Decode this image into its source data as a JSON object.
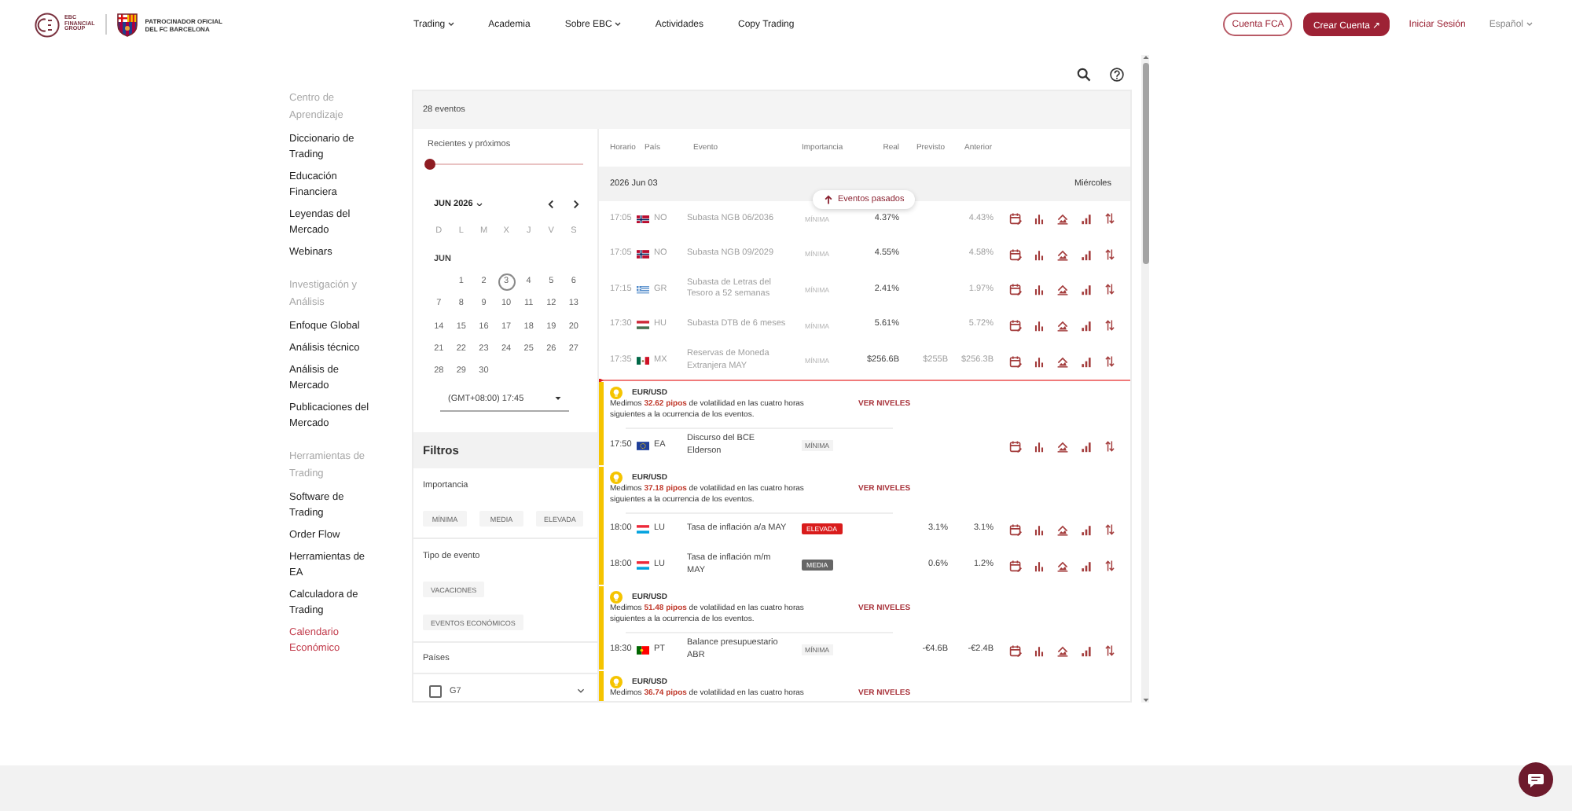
{
  "header": {
    "logo_text": "EBC FINANCIAL GROUP",
    "sponsor_text": "PATROCINADOR OFICIAL DEL FC BARCELONA",
    "nav": [
      {
        "label": "Trading",
        "has_menu": true
      },
      {
        "label": "Academia",
        "has_menu": false
      },
      {
        "label": "Sobre EBC",
        "has_menu": true
      },
      {
        "label": "Actividades",
        "has_menu": false
      },
      {
        "label": "Copy Trading",
        "has_menu": false
      }
    ],
    "actions": [
      {
        "label": "Cuenta FCA",
        "kind": "outline"
      },
      {
        "label": "Crear Cuenta ↗",
        "kind": "filled"
      },
      {
        "label": "Iniciar Sesión",
        "kind": "link"
      },
      {
        "label": "Español",
        "kind": "language"
      }
    ]
  },
  "sidebar": {
    "sections": [
      {
        "title": "Centro de Aprendizaje",
        "items": [
          {
            "label": "Diccionario de Trading",
            "selected": false
          },
          {
            "label": "Educación Financiera",
            "selected": false
          },
          {
            "label": "Leyendas del Mercado",
            "selected": false
          },
          {
            "label": "Webinars",
            "selected": false
          }
        ]
      },
      {
        "title": "Investigación y Análisis",
        "items": [
          {
            "label": "Enfoque Global",
            "selected": false
          },
          {
            "label": "Análisis técnico",
            "selected": false
          },
          {
            "label": "Análisis de Mercado",
            "selected": false
          },
          {
            "label": "Publicaciones del Mercado",
            "selected": false
          }
        ]
      },
      {
        "title": "Herramientas de Trading",
        "items": [
          {
            "label": "Software de Trading",
            "selected": false
          },
          {
            "label": "Order Flow",
            "selected": false
          },
          {
            "label": "Herramientas de EA",
            "selected": false
          },
          {
            "label": "Calculadora de Trading",
            "selected": false
          },
          {
            "label": "Calendario Económico",
            "selected": true
          }
        ]
      }
    ]
  },
  "calendar": {
    "event_count": "28 eventos",
    "range": {
      "label": "Recientes y próximos",
      "level": 0
    },
    "month_label": "JUN 2026",
    "weekdays": [
      "D",
      "L",
      "M",
      "X",
      "J",
      "V",
      "S"
    ],
    "month_heading": "JUN",
    "weeks": [
      {
        "kind": "leading",
        "days": [
          {
            "day": "1",
            "selected": false
          },
          {
            "day": "2",
            "selected": false
          },
          {
            "day": "3",
            "selected": true
          },
          {
            "day": "4",
            "selected": false
          },
          {
            "day": "5",
            "selected": false
          },
          {
            "day": "6",
            "selected": false
          }
        ]
      },
      {
        "kind": "full",
        "days": [
          {
            "day": "7",
            "selected": false
          },
          {
            "day": "8",
            "selected": false
          },
          {
            "day": "9",
            "selected": false
          },
          {
            "day": "10",
            "selected": false
          },
          {
            "day": "11",
            "selected": false
          },
          {
            "day": "12",
            "selected": false
          },
          {
            "day": "13",
            "selected": false
          }
        ]
      },
      {
        "kind": "full",
        "days": [
          {
            "day": "14",
            "selected": false
          },
          {
            "day": "15",
            "selected": false
          },
          {
            "day": "16",
            "selected": false
          },
          {
            "day": "17",
            "selected": false
          },
          {
            "day": "18",
            "selected": false
          },
          {
            "day": "19",
            "selected": false
          },
          {
            "day": "20",
            "selected": false
          }
        ]
      },
      {
        "kind": "full",
        "days": [
          {
            "day": "21",
            "selected": false
          },
          {
            "day": "22",
            "selected": false
          },
          {
            "day": "23",
            "selected": false
          },
          {
            "day": "24",
            "selected": false
          },
          {
            "day": "25",
            "selected": false
          },
          {
            "day": "26",
            "selected": false
          },
          {
            "day": "27",
            "selected": false
          }
        ]
      },
      {
        "kind": "trailing",
        "days": [
          {
            "day": "28",
            "selected": false
          },
          {
            "day": "29",
            "selected": false
          },
          {
            "day": "30",
            "selected": false
          }
        ]
      }
    ],
    "timezone": "(GMT+08:00) 17:45"
  },
  "filters": {
    "title": "Filtros",
    "groups": [
      {
        "title": "Importancia",
        "kind": "chips",
        "options": [
          {
            "label": "MÍNIMA",
            "selected": false
          },
          {
            "label": "MEDIA",
            "selected": false
          },
          {
            "label": "ELEVADA",
            "selected": false
          }
        ]
      },
      {
        "title": "Tipo de evento",
        "kind": "chips",
        "options": [
          {
            "label": "VACACIONES",
            "selected": false
          },
          {
            "label": "EVENTOS ECONÓMICOS",
            "selected": false
          }
        ]
      },
      {
        "title": "Países",
        "kind": "checklist",
        "options": [
          {
            "label": "G7",
            "checked": false,
            "expanded": false
          }
        ]
      }
    ]
  },
  "events": {
    "columns": [
      "Horario",
      "País",
      "Evento",
      "Importancia",
      "Real",
      "Previsto",
      "Anterior"
    ],
    "date": "2026 Jun 03",
    "weekday": "Miércoles",
    "past_button": "Eventos pasados",
    "past_rows": [
      {
        "time": "17:05",
        "country": {
          "code": "NO",
          "kind": "norway"
        },
        "event": "Subasta NGB 06/2036",
        "importance": {
          "label": "MÍNIMA",
          "kind": "low"
        },
        "actual": "4.37%",
        "previous": "4.43%",
        "past": true
      },
      {
        "time": "17:05",
        "country": {
          "code": "NO",
          "kind": "norway"
        },
        "event": "Subasta NGB 09/2029",
        "importance": {
          "label": "MÍNIMA",
          "kind": "low"
        },
        "actual": "4.55%",
        "previous": "4.58%",
        "past": true
      },
      {
        "time": "17:15",
        "country": {
          "code": "GR",
          "kind": "greece"
        },
        "event": "Subasta de Letras del Tesoro a 52 semanas",
        "importance": {
          "label": "MÍNIMA",
          "kind": "low"
        },
        "actual": "2.41%",
        "previous": "1.97%",
        "past": true
      },
      {
        "time": "17:30",
        "country": {
          "code": "HU",
          "kind": "hungary"
        },
        "event": "Subasta DTB de 6 meses",
        "importance": {
          "label": "MÍNIMA",
          "kind": "low"
        },
        "actual": "5.61%",
        "previous": "5.72%",
        "past": true
      },
      {
        "time": "17:35",
        "country": {
          "code": "MX",
          "kind": "mexico"
        },
        "event": "Reservas de Moneda Extranjera MAY",
        "importance": {
          "label": "MÍNIMA",
          "kind": "low"
        },
        "actual": "$256.6B",
        "forecast": "$255B",
        "previous": "$256.3B",
        "past": true
      }
    ],
    "groups": [
      {
        "pair": "EUR/USD",
        "message": "Medimos **32.62 pipos** de volatilidad en las cuatro horas siguientes a la ocurrencia de los eventos.",
        "link": "VER NIVELES",
        "rows": [
          {
            "time": "17:50",
            "country": {
              "code": "EA",
              "kind": "european_union"
            },
            "event": "Discurso del BCE Elderson",
            "importance": {
              "label": "MÍNIMA",
              "kind": "low"
            },
            "past": false
          }
        ]
      },
      {
        "pair": "EUR/USD",
        "message": "Medimos **37.18 pipos** de volatilidad en las cuatro horas siguientes a la ocurrencia de los eventos.",
        "link": "VER NIVELES",
        "rows": [
          {
            "time": "18:00",
            "country": {
              "code": "LU",
              "kind": "luxembourg"
            },
            "event": "Tasa de inflación a/a MAY",
            "importance": {
              "label": "ELEVADA",
              "kind": "high"
            },
            "forecast": "3.1%",
            "previous": "3.1%",
            "past": false
          },
          {
            "time": "18:00",
            "country": {
              "code": "LU",
              "kind": "luxembourg"
            },
            "event": "Tasa de inflación m/m MAY",
            "importance": {
              "label": "MEDIA",
              "kind": "medium"
            },
            "forecast": "0.6%",
            "previous": "1.2%",
            "past": false
          }
        ]
      },
      {
        "pair": "EUR/USD",
        "message": "Medimos **51.48 pipos** de volatilidad en las cuatro horas siguientes a la ocurrencia de los eventos.",
        "link": "VER NIVELES",
        "rows": [
          {
            "time": "18:30",
            "country": {
              "code": "PT",
              "kind": "portugal"
            },
            "event": "Balance presupuestario ABR",
            "importance": {
              "label": "MÍNIMA",
              "kind": "low"
            },
            "forecast": "-€4.6B",
            "previous": "-€2.4B",
            "past": false
          }
        ]
      },
      {
        "pair": "EUR/USD",
        "message": "Medimos **36.74 pipos** de volatilidad en las cuatro horas",
        "link": "VER NIVELES"
      }
    ]
  }
}
